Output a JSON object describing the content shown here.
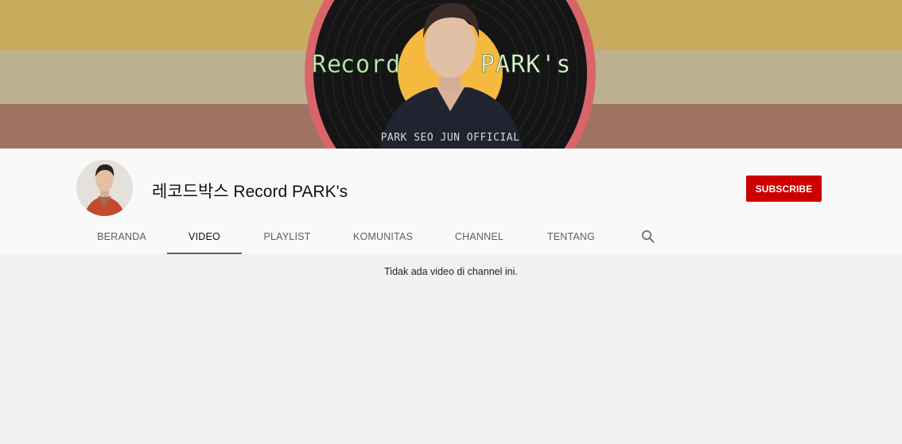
{
  "banner": {
    "logo_text": "Record PARK's",
    "logo_partial": "Re",
    "subtitle": "PARK SEO JUN OFFICIAL",
    "colors": {
      "stripe_top": "#c9ab5e",
      "stripe_mid": "#bcb08e",
      "stripe_bottom": "#9e7460",
      "record_rim": "#d9656b",
      "record_label": "#f5b940"
    }
  },
  "channel": {
    "name": "레코드박스 Record PARK's",
    "subscribe_label": "SUBSCRIBE",
    "subscribe_color": "#cc0000"
  },
  "tabs": [
    {
      "label": "BERANDA"
    },
    {
      "label": "VIDEO",
      "active": true
    },
    {
      "label": "PLAYLIST"
    },
    {
      "label": "KOMUNITAS"
    },
    {
      "label": "CHANNEL"
    },
    {
      "label": "TENTANG"
    }
  ],
  "search_icon": "search-icon",
  "content": {
    "empty_message": "Tidak ada video di channel ini."
  }
}
